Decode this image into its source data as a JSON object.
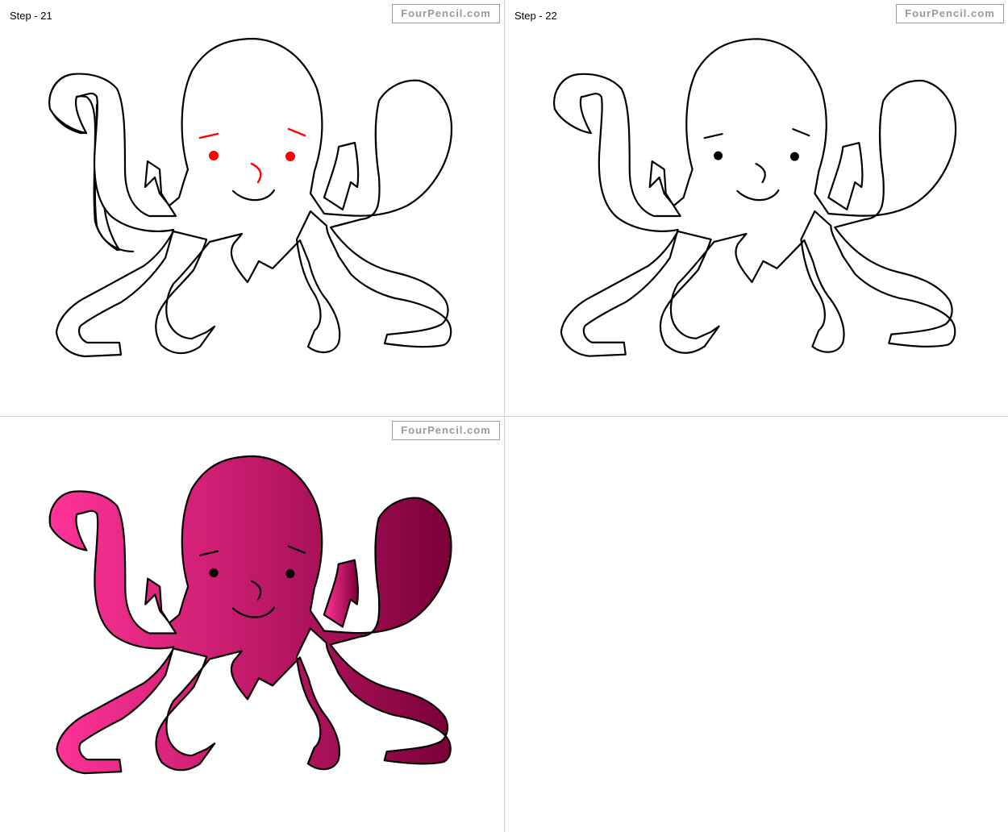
{
  "watermark": "FourPencil.com",
  "panels": [
    {
      "step_label": "Step - 21",
      "highlight_color": "#ff0000"
    },
    {
      "step_label": "Step - 22"
    },
    {
      "step_label": "",
      "fill_gradient": [
        "#ff3399",
        "#cc1a66",
        "#7a0038"
      ]
    }
  ],
  "icons": {
    "figure": "octopus-drawing"
  }
}
